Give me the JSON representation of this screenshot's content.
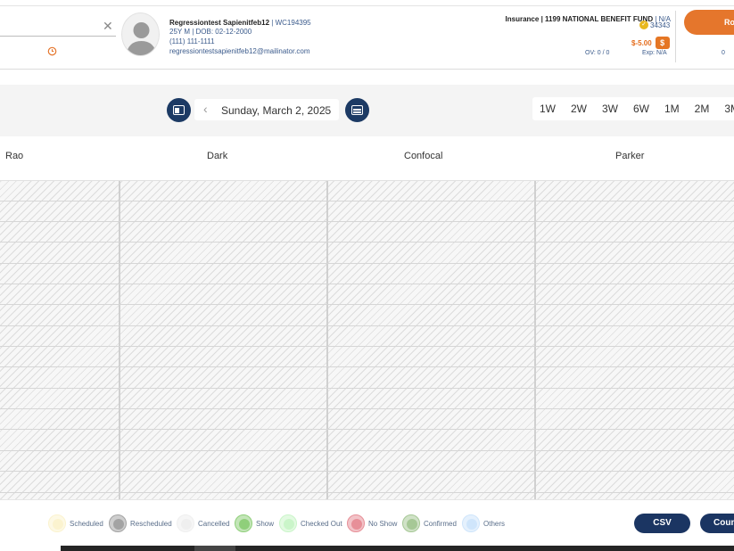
{
  "patient": {
    "name": "Regressiontest Sapienitfeb12",
    "id": "WC194395",
    "demographics": "25Y M | DOB: 02-12-2000",
    "phone": "(111) 111-1111",
    "email": "regressiontestsapienitfeb12@mailinator.com"
  },
  "insurance": {
    "label": "Insurance",
    "plan": "1199 NATIONAL BENEFIT FUND",
    "value": "N/A",
    "points": "34343",
    "balance": "$-5.00",
    "dollar_symbol": "$",
    "ov": "OV: 0 / 0",
    "exp": "Exp: N/A"
  },
  "header_right": {
    "button_label": "Ro",
    "count": "0"
  },
  "search": {
    "clear_symbol": "✕"
  },
  "toolbar": {
    "prev_symbol": "‹",
    "next_symbol": "›",
    "date": "Sunday, March 2, 2025",
    "ranges": [
      "1W",
      "2W",
      "3W",
      "6W",
      "1M",
      "2M",
      "3M"
    ]
  },
  "columns": [
    "Rao",
    "Dark",
    "Confocal",
    "Parker"
  ],
  "legend": [
    {
      "label": "Scheduled",
      "color": "#fbf3cf"
    },
    {
      "label": "Rescheduled",
      "color": "#a3a3a3"
    },
    {
      "label": "Cancelled",
      "color": "#efefef"
    },
    {
      "label": "Show",
      "color": "#8fcf7a"
    },
    {
      "label": "Checked Out",
      "color": "#caf5c9"
    },
    {
      "label": "No Show",
      "color": "#e78f98"
    },
    {
      "label": "Confirmed",
      "color": "#a6c896"
    },
    {
      "label": "Others",
      "color": "#cfe5fb"
    }
  ],
  "actions": {
    "csv": "CSV",
    "count_btn": "Coun"
  }
}
